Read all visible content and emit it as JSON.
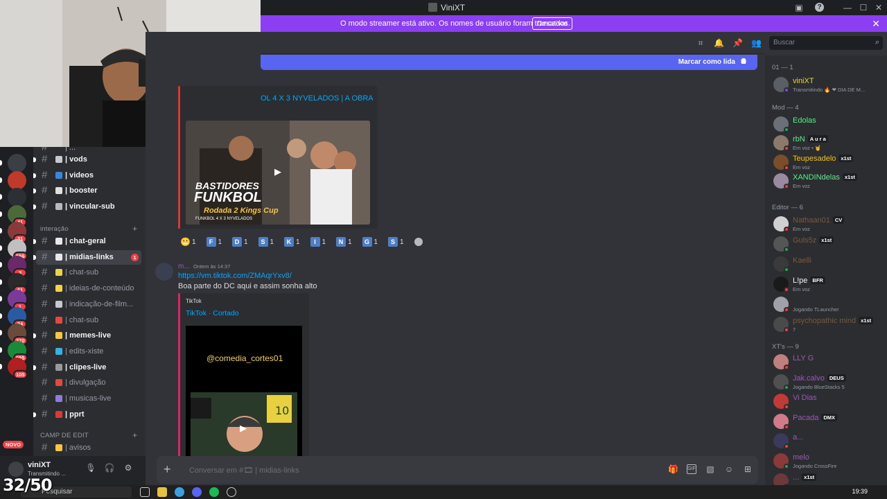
{
  "window": {
    "title": "ViniXT"
  },
  "banner": {
    "message": "O modo streamer está ativo. Os nomes de usuário foram truncados.",
    "button": "Desativar"
  },
  "servers": [
    {
      "badge": ""
    },
    {
      "badge": ""
    },
    {
      "badge": ""
    },
    {
      "badge": "41"
    },
    {
      "badge": "31"
    },
    {
      "badge": "566"
    },
    {
      "badge": "3"
    },
    {
      "badge": "61"
    },
    {
      "badge": "1"
    },
    {
      "badge": "24"
    },
    {
      "badge": "270"
    },
    {
      "badge": "985"
    },
    {
      "badge": "105"
    }
  ],
  "server_new_label": "NOVO",
  "channels": {
    "partial_top": "| ...",
    "items_top": [
      {
        "name": "| vods",
        "bright": true,
        "emoji_color": "#c7c9cc"
      },
      {
        "name": "| videos",
        "bright": true,
        "emoji_color": "#3a87d8"
      },
      {
        "name": "| booster",
        "bright": true,
        "emoji_color": "#e0e0e0"
      },
      {
        "name": "| vincular-sub",
        "bright": true,
        "emoji_color": "#b5bac1"
      }
    ],
    "category_interacao": "interação",
    "items_interacao": [
      {
        "name": "| chat-geral",
        "bright": true,
        "emoji_color": "#e8e8e8"
      },
      {
        "name": "| midias-links",
        "bright": true,
        "active": true,
        "emoji_color": "#e8e8e8",
        "unread": "1"
      },
      {
        "name": "| chat-sub",
        "bright": false,
        "emoji_color": "#e8d44d"
      },
      {
        "name": "| ideias-de-conteúdo",
        "bright": false,
        "emoji_color": "#f6d14a"
      },
      {
        "name": "| indicação-de-film...",
        "bright": false,
        "emoji_color": "#c7c9cc"
      },
      {
        "name": "| chat-sub",
        "bright": false,
        "emoji_color": "#e04a3f"
      },
      {
        "name": "| memes-live",
        "bright": true,
        "emoji_color": "#f6c544"
      },
      {
        "name": "| edits-xiste",
        "bright": false,
        "emoji_color": "#3ab0e0"
      },
      {
        "name": "| clipes-live",
        "bright": true,
        "emoji_color": "#9a9a9a"
      },
      {
        "name": "| divulgação",
        "bright": false,
        "emoji_color": "#e04a3f"
      },
      {
        "name": "| musicas-live",
        "bright": false,
        "emoji_color": "#8e7dd8"
      },
      {
        "name": "| pprt",
        "bright": true,
        "emoji_color": "#d83a3a"
      }
    ],
    "category_camp": "CAMP DE EDIT",
    "items_camp": [
      {
        "name": "| avisos",
        "bright": false,
        "emoji_color": "#f6c544"
      }
    ]
  },
  "user": {
    "name": "viniXT",
    "status": "Transmitindo ..."
  },
  "chat": {
    "unread_bar": "Marcar como lida",
    "embed1_title": "OL  4 X  3 NYVELADOS | A OBRA",
    "video1_line1": "BASTIDORES",
    "video1_line2": "FUNKBOL",
    "video1_line3": "Rodada 2 Kings Cup",
    "video1_line4": "FUNKBOL 4 X 3 NYVELADOS",
    "reactions": [
      {
        "label": "😬",
        "count": "1"
      },
      {
        "label": "F",
        "count": "1"
      },
      {
        "label": "D",
        "count": "1"
      },
      {
        "label": "S",
        "count": "1"
      },
      {
        "label": "K",
        "count": "1"
      },
      {
        "label": "I",
        "count": "1"
      },
      {
        "label": "N",
        "count": "1"
      },
      {
        "label": "G",
        "count": "1"
      },
      {
        "label": "S",
        "count": "1"
      }
    ],
    "msg2": {
      "author": "m...",
      "timestamp": "Ontem às 14:37",
      "link": "https://vm.tiktok.com/ZMAqrYxv8/",
      "text": "Boa parte do DC aqui e assim sonha alto",
      "embed_provider": "TikTok",
      "embed_title": "TikTok · Cortado",
      "video_caption": "@comedia_cortes01"
    },
    "composer_placeholder": "Conversar em #🎞 | midias-links"
  },
  "search": {
    "placeholder": "Buscar"
  },
  "members": {
    "groups": [
      {
        "title": "01 — 1"
      },
      {
        "title": "Mod — 4"
      },
      {
        "title": "Editor — 6"
      },
      {
        "title": "XT's — 9"
      }
    ],
    "owner": [
      {
        "name": "viniXT",
        "status": "Transmitindo 🔥 ❤ DIA DE M...",
        "color": "#e8d44d",
        "avatar": "#5a5f66",
        "dot": "#8c3ff2"
      }
    ],
    "mods": [
      {
        "name": "Edolas",
        "status": "",
        "color": "#57f287",
        "avatar": "#6b6f77",
        "dot": "#23a55a"
      },
      {
        "name": "rbN",
        "tag": "A u r a",
        "status": "Em voz • 🤘",
        "color": "#57f287",
        "avatar": "#8a7a6a",
        "dot": "#f23f43"
      },
      {
        "name": "Teupesadelo",
        "tag": "x1st",
        "status": "Em voz",
        "color": "#f1c40f",
        "avatar": "#7a4e2a",
        "dot": "#f23f43"
      },
      {
        "name": "XANDINdelas",
        "tag": "x1st",
        "status": "Em voz",
        "color": "#57f287",
        "avatar": "#9a8aa0",
        "dot": "#f23f43"
      }
    ],
    "editors": [
      {
        "name": "Nathaan01",
        "tag": "CV",
        "status": "Em voz",
        "color": "#7a5a3a",
        "avatar": "#d0d0d0",
        "dot": "#f23f43"
      },
      {
        "name": "Guls5z",
        "tag": "x1st",
        "status": "",
        "color": "#7a5a3a",
        "avatar": "#555",
        "dot": "#23a55a"
      },
      {
        "name": "Kaelli",
        "status": "",
        "color": "#7a5a3a",
        "avatar": "#3a3a3a",
        "dot": "#23a55a"
      },
      {
        "name": "L!pe",
        "tag": "BFR",
        "status": "Em voz",
        "color": "#f2f3f5",
        "avatar": "#1a1a1a",
        "dot": "#f23f43"
      },
      {
        "name": "",
        "status": "Jogando TLauncher",
        "color": "#f2f3f5",
        "avatar": "#a0a0a8",
        "dot": "#f23f43"
      },
      {
        "name": "psychopathic mind",
        "tag": "x1st",
        "status": "7",
        "color": "#7a5a3a",
        "avatar": "#4a4a4a",
        "dot": "#f23f43"
      }
    ],
    "xts": [
      {
        "name": "LLY G",
        "status": "",
        "color": "#9b59b6",
        "avatar": "#c08080",
        "dot": "#f23f43"
      },
      {
        "name": "Jak.calvo",
        "tag": "DEUS",
        "status": "Jogando BlueStacks 5",
        "color": "#9b59b6",
        "avatar": "#505050",
        "dot": "#23a55a"
      },
      {
        "name": "Vi Dias",
        "status": "",
        "color": "#9b59b6",
        "avatar": "#c03a3a",
        "dot": "#f23f43"
      },
      {
        "name": "Pacada",
        "tag": "DMX",
        "status": "",
        "color": "#9b59b6",
        "avatar": "#d07a8a",
        "dot": "#f23f43"
      },
      {
        "name": "a...",
        "status": "",
        "color": "#9b59b6",
        "avatar": "#3a3a5a",
        "dot": "#f23f43"
      },
      {
        "name": "melo",
        "status": "Jogando CrossFire",
        "color": "#9b59b6",
        "avatar": "#8a3a3a",
        "dot": "#23a55a"
      },
      {
        "name": "...",
        "tag": "x1st",
        "status": "",
        "color": "#9b59b6",
        "avatar": "#6a3a3a",
        "dot": "#f23f43"
      }
    ]
  },
  "taskbar": {
    "search_placeholder": "Pesquisar",
    "time": "19:39"
  },
  "overlay_counter": "32/50"
}
